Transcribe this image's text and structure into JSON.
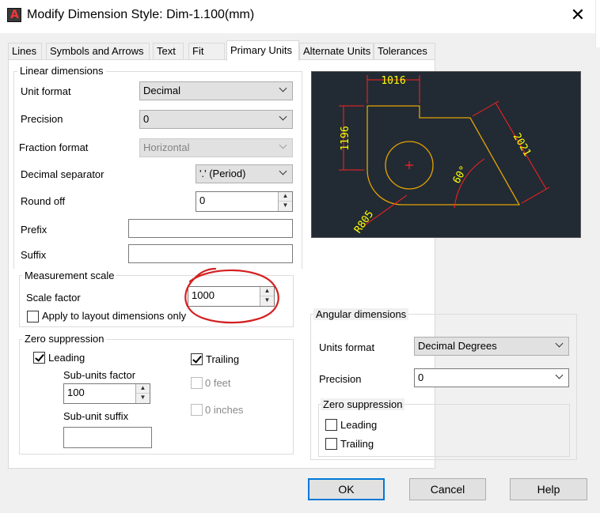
{
  "window": {
    "title": "Modify Dimension Style: Dim-1.100(mm)",
    "close_glyph": "✕",
    "app_icon_glyph": "A"
  },
  "tabs": [
    {
      "label": "Lines"
    },
    {
      "label": "Symbols and Arrows"
    },
    {
      "label": "Text"
    },
    {
      "label": "Fit"
    },
    {
      "label": "Primary Units"
    },
    {
      "label": "Alternate Units"
    },
    {
      "label": "Tolerances"
    }
  ],
  "active_tab": "Primary Units",
  "linear": {
    "group_label": "Linear dimensions",
    "unit_format": {
      "label": "Unit format",
      "value": "Decimal"
    },
    "precision": {
      "label": "Precision",
      "value": "0"
    },
    "fraction_format": {
      "label": "Fraction format",
      "value": "Horizontal"
    },
    "decimal_separator": {
      "label": "Decimal separator",
      "value": "'.' (Period)"
    },
    "round_off": {
      "label": "Round off",
      "value": "0"
    },
    "prefix": {
      "label": "Prefix",
      "value": ""
    },
    "suffix": {
      "label": "Suffix",
      "value": ""
    }
  },
  "measurement": {
    "group_label": "Measurement scale",
    "scale_factor": {
      "label": "Scale factor",
      "value": "1000"
    },
    "apply_layout": {
      "label": "Apply to layout dimensions only",
      "checked": false
    }
  },
  "zero_suppression": {
    "group_label": "Zero suppression",
    "leading": {
      "label": "Leading",
      "checked": true
    },
    "trailing": {
      "label": "Trailing",
      "checked": true
    },
    "sub_units_factor": {
      "label": "Sub-units factor",
      "value": "100"
    },
    "sub_unit_suffix": {
      "label": "Sub-unit suffix",
      "value": ""
    },
    "feet": {
      "label": "0 feet",
      "checked": false,
      "enabled": false
    },
    "inches": {
      "label": "0 inches",
      "checked": false,
      "enabled": false
    }
  },
  "angular": {
    "group_label": "Angular dimensions",
    "units_format": {
      "label": "Units format",
      "value": "Decimal Degrees"
    },
    "precision": {
      "label": "Precision",
      "value": "0"
    },
    "zero_suppression": {
      "group_label": "Zero suppression",
      "leading": {
        "label": "Leading",
        "checked": false
      },
      "trailing": {
        "label": "Trailing",
        "checked": false
      }
    }
  },
  "preview": {
    "dim_top": "1016",
    "dim_left": "1196",
    "dim_diag": "2021",
    "dim_angle": "60°",
    "dim_radius": "R805",
    "colors": {
      "background": "#222b34",
      "geometry": "#e6a300",
      "dimension": "#ff2020",
      "text": "#ffff00"
    }
  },
  "buttons": {
    "ok": "OK",
    "cancel": "Cancel",
    "help": "Help"
  },
  "annotation": {
    "color": "#d42020"
  }
}
